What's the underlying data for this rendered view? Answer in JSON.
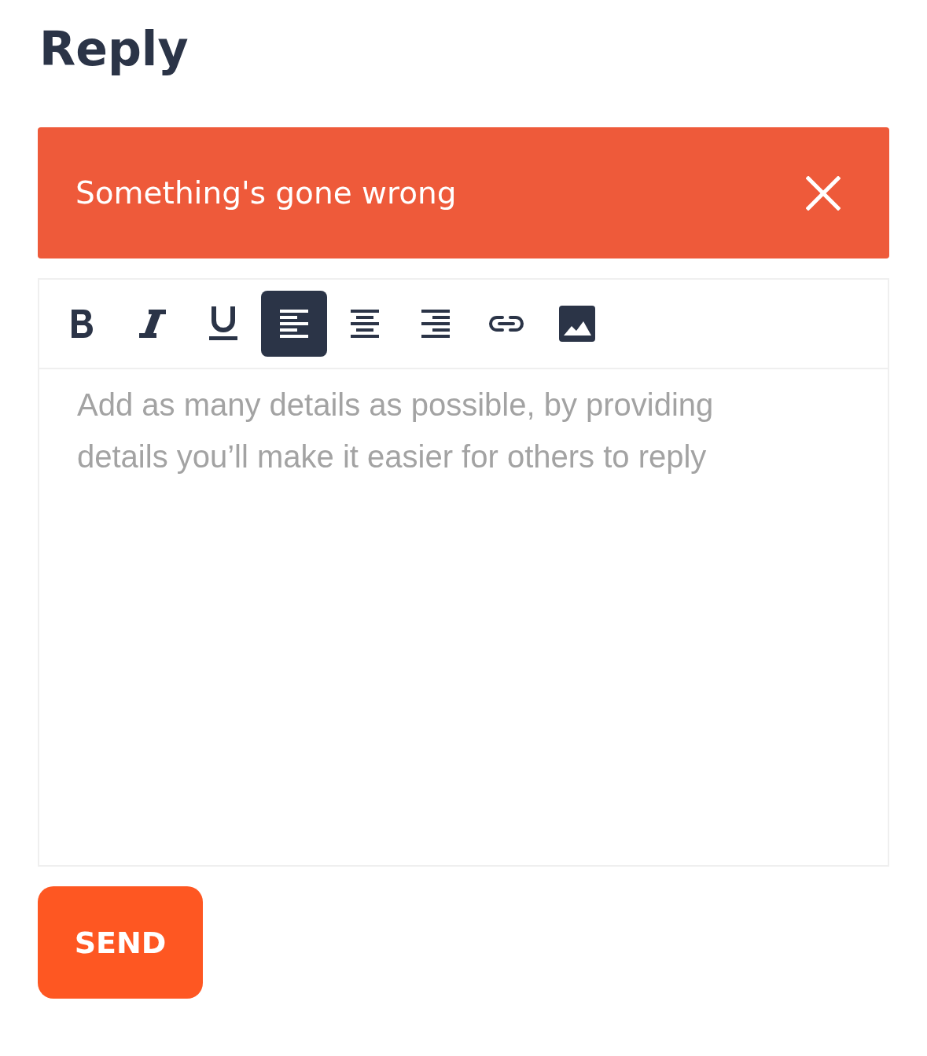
{
  "title": "Reply",
  "alert": {
    "message": "Something's gone wrong"
  },
  "toolbar": [
    {
      "kind": "bold",
      "selected": false
    },
    {
      "kind": "italic",
      "selected": false
    },
    {
      "kind": "underline",
      "selected": false
    },
    {
      "kind": "align-left",
      "selected": true
    },
    {
      "kind": "align-center",
      "selected": false
    },
    {
      "kind": "align-right",
      "selected": false
    },
    {
      "kind": "link",
      "selected": false
    },
    {
      "kind": "image",
      "selected": false
    }
  ],
  "editor": {
    "placeholder": "Add as many details as possible, by providing details you’ll make it easier for others to reply"
  },
  "send_button": "SEND"
}
